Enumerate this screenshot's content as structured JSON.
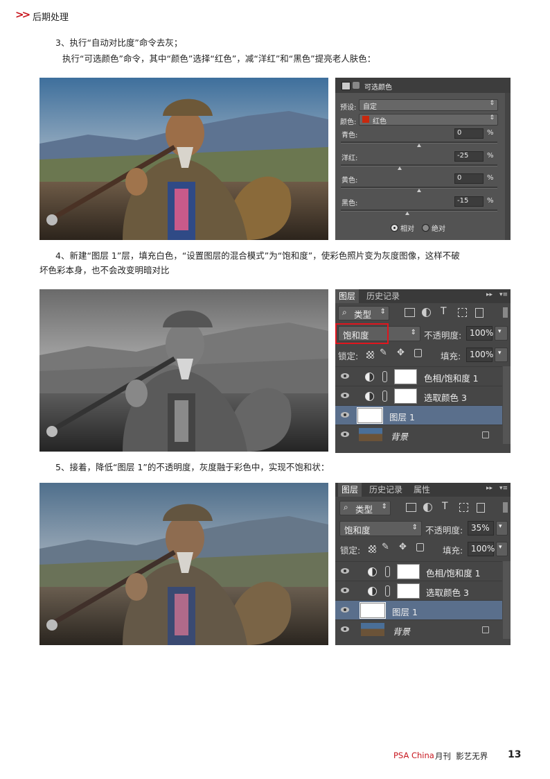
{
  "header": {
    "section": "后期处理"
  },
  "step3": {
    "line1": "3、执行“自动对比度”命令去灰；",
    "line2": "执行“可选颜色”命令，其中“颜色”选择“红色”，减“洋红”和“黑色”提亮老人肤色："
  },
  "selective_color": {
    "title": "可选颜色",
    "preset_label": "预设:",
    "preset_value": "自定",
    "color_label": "颜色:",
    "color_value": "红色",
    "color_swatch": "#c8280e",
    "sliders": [
      {
        "label": "青色:",
        "value": "0",
        "unit": "%",
        "level": 0.5
      },
      {
        "label": "洋红:",
        "value": "-25",
        "unit": "%",
        "level": 0.375
      },
      {
        "label": "黄色:",
        "value": "0",
        "unit": "%",
        "level": 0.5
      },
      {
        "label": "黑色:",
        "value": "-15",
        "unit": "%",
        "level": 0.425
      }
    ],
    "method_relative": "相对",
    "method_absolute": "绝对",
    "method_selected": "相对"
  },
  "step4": {
    "line1": "4、新建“图层 1”层，填充白色，“设置图层的混合模式”为“饱和度”，使彩色照片变为灰度图像，这样不破",
    "line2": "坏色彩本身，也不会改变明暗对比"
  },
  "layers_panel_1": {
    "tabs": [
      "图层",
      "历史记录"
    ],
    "filter_label": "类型",
    "blend_mode": "饱和度",
    "opacity_label": "不透明度:",
    "opacity_value": "100%",
    "lock_label": "锁定:",
    "fill_label": "填充:",
    "fill_value": "100%",
    "highlight_color": "#e0161e",
    "layers": [
      {
        "name": "色相/饱和度 1",
        "type": "adjustment"
      },
      {
        "name": "选取颜色 3",
        "type": "adjustment"
      },
      {
        "name": "图层 1",
        "type": "fill",
        "selected": true
      },
      {
        "name": "背景",
        "type": "background"
      }
    ]
  },
  "step5": {
    "line1": "5、接着，降低“图层 1”的不透明度，灰度融于彩色中，实现不饱和状："
  },
  "layers_panel_2": {
    "tabs": [
      "图层",
      "历史记录",
      "属性"
    ],
    "filter_label": "类型",
    "blend_mode": "饱和度",
    "opacity_label": "不透明度:",
    "opacity_value": "35%",
    "lock_label": "锁定:",
    "fill_label": "填充:",
    "fill_value": "100%",
    "layers": [
      {
        "name": "色相/饱和度 1",
        "type": "adjustment"
      },
      {
        "name": "选取颜色 3",
        "type": "adjustment"
      },
      {
        "name": "图层 1",
        "type": "fill",
        "selected": true
      },
      {
        "name": "背景",
        "type": "background"
      }
    ]
  },
  "footer": {
    "brand": "PSA China",
    "publication": "月刊  影艺无界",
    "page_number": "13"
  }
}
